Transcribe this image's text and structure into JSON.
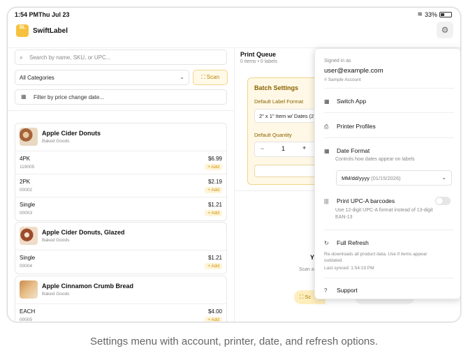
{
  "status": {
    "time": "1:54 PM",
    "date": "Thu Jul 23",
    "battery": "33%"
  },
  "app": {
    "logo_text": "SL",
    "name": "SwiftLabel"
  },
  "search": {
    "placeholder": "Search by name, SKU, or UPC..."
  },
  "filters": {
    "category": "All Categories",
    "scan_label": "Scan",
    "price_filter": "Filter by price change date..."
  },
  "products": [
    {
      "name": "Apple Cider Donuts",
      "category": "Baked Goods",
      "variants": [
        {
          "name": "4PK",
          "code": "119005",
          "price": "$6.99",
          "add": "+ Add"
        },
        {
          "name": "2PK",
          "code": "00002",
          "price": "$2.19",
          "add": "+ Add"
        },
        {
          "name": "Single",
          "code": "00003",
          "price": "$1.21",
          "add": "+ Add"
        }
      ]
    },
    {
      "name": "Apple Cider Donuts, Glazed",
      "category": "Baked Goods",
      "variants": [
        {
          "name": "Single",
          "code": "00004",
          "price": "$1.21",
          "add": "+ Add"
        }
      ]
    },
    {
      "name": "Apple Cinnamon Crumb Bread",
      "category": "Baked Goods",
      "variants": [
        {
          "name": "EACH",
          "code": "00005",
          "price": "$4.00",
          "add": "+ Add"
        }
      ]
    }
  ],
  "queue": {
    "title": "Print Queue",
    "subtitle": "0 items • 0 labels",
    "batch_title": "Batch Settings",
    "format_label": "Default Label Format",
    "format_value": "2\" x 1\" Item w/ Dates (2",
    "qty_label": "Default Quantity",
    "qty_value": "1",
    "empty_title": "Y",
    "empty_sub": "Scan a",
    "scan_button": "Sc"
  },
  "menu": {
    "signed_in_label": "Signed in as",
    "email": "user@example.com",
    "account": "Sample Account",
    "switch_app": "Switch App",
    "printer_profiles": "Printer Profiles",
    "date_format_title": "Date Format",
    "date_format_desc": "Controls how dates appear on labels",
    "date_format_value": "MM/dd/yyyy",
    "date_format_example": "(01/15/2026)",
    "upc_title": "Print UPC-A barcodes",
    "upc_desc_1": "Use 12-digit UPC-A format instead of 13-digit",
    "upc_desc_2": "EAN-13",
    "upc_enabled": false,
    "refresh_title": "Full Refresh",
    "refresh_desc_1": "Re-downloads all product data. Use if items appear",
    "refresh_desc_2": "outdated.",
    "last_synced": "Last synced: 1:54:19 PM",
    "support": "Support"
  },
  "caption": "Settings menu with account, printer, date, and refresh options."
}
